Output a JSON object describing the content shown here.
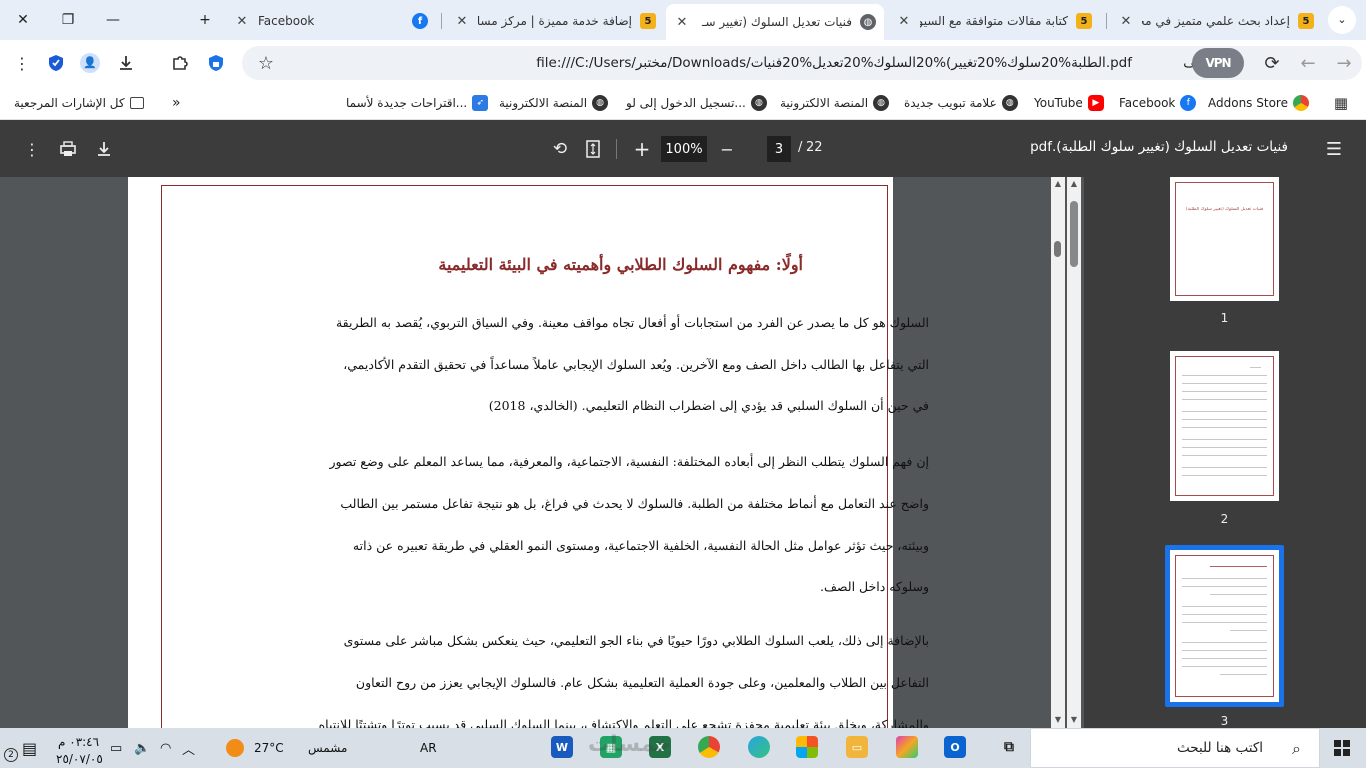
{
  "tabs": [
    {
      "title": "إعداد بحث علمي متميز في مخـ",
      "favicon": "5"
    },
    {
      "title": "كتابة مقالات متوافقة مع السيو",
      "favicon": "5"
    },
    {
      "title": "فنيات تعديل السلوك (تغيير سـ",
      "favicon": "globe"
    },
    {
      "title": "إضافة خدمة مميزة | مركز مساعـ",
      "favicon": "5"
    },
    {
      "title": "Facebook",
      "favicon": "facebook"
    }
  ],
  "window": {
    "new_tab": "+",
    "minimize": "—",
    "restore": "❐",
    "close": "✕"
  },
  "omnibox": {
    "file_label": "ملف",
    "url": "file:///C:/Users/مختبر/Downloads/الطلبة%20سلوك%20تغيير)%20السلوك%20تعديل%20فنيات.pdf",
    "vpn_label": "VPN"
  },
  "bookmarks": [
    {
      "label": "Addons Store",
      "icon": "store"
    },
    {
      "label": "Facebook",
      "icon": "facebook"
    },
    {
      "label": "YouTube",
      "icon": "youtube"
    },
    {
      "label": "علامة تبويب جديدة",
      "icon": "globe"
    },
    {
      "label": "المنصة الالكترونية",
      "icon": "globe"
    },
    {
      "label": "تسجيل الدخول إلى لو...",
      "icon": "globe"
    },
    {
      "label": "المنصة الالكترونية",
      "icon": "globe"
    },
    {
      "label": "اقتراحات جديدة لأسما...",
      "icon": "bird"
    },
    {
      "label": "كل الإشارات المرجعية",
      "icon": "folder"
    }
  ],
  "pdf_toolbar": {
    "doc_title": "فنيات تعديل السلوك (تغيير سلوك الطلبة).pdf",
    "current_page": "3",
    "page_sep": "/",
    "total_pages": "22",
    "zoom": "100%"
  },
  "pdf_page": {
    "heading": "أولًا: مفهوم السلوك الطلابي وأهميته في البيئة التعليمية",
    "lines": [
      "السلوك هو كل ما يصدر عن الفرد من استجابات أو أفعال تجاه مواقف معينة. وفي السياق التربوي، يُقصد به الطريقة",
      "التي يتفاعل بها الطالب داخل الصف ومع الآخرين. ويُعد السلوك الإيجابي عاملاً مساعداً في تحقيق التقدم الأكاديمي،",
      "في حين أن السلوك السلبي قد يؤدي إلى اضطراب النظام التعليمي. (الخالدي، 2018)",
      "إن فهم السلوك يتطلب النظر إلى أبعاده المختلفة: النفسية، الاجتماعية، والمعرفية، مما يساعد المعلم على وضع تصور",
      "واضح عند التعامل مع أنماط مختلفة من الطلبة. فالسلوك لا يحدث في فراغ، بل هو نتيجة تفاعل مستمر بين الطالب",
      "وبيئته، حيث تؤثر عوامل مثل الحالة النفسية، الخلفية الاجتماعية، ومستوى النمو العقلي في طريقة تعبيره عن ذاته",
      "وسلوكه داخل الصف.",
      "بالإضافة إلى ذلك، يلعب السلوك الطلابي دورًا حيويًا في بناء الجو التعليمي، حيث ينعكس بشكل مباشر على مستوى",
      "التفاعل بين الطلاب والمعلمين، وعلى جودة العملية التعليمية بشكل عام. فالسلوك الإيجابي يعزز من روح التعاون",
      "والمشاركة، ويخلق بيئة تعليمية محفزة تشجع على التعلم والاكتشاف، بينما السلوك السلبي قد يسبب توترًا وتشتتًا للانتباه"
    ]
  },
  "thumbnails": [
    {
      "num": "1",
      "title_text": "فنيات تعديل السلوك (تغيير سلوك الطلبة)"
    },
    {
      "num": "2"
    },
    {
      "num": "3",
      "selected": true
    }
  ],
  "taskbar": {
    "search_placeholder": "اكتب هنا للبحث",
    "weather_temp": "27°C",
    "weather_label": "مشمس",
    "language": "AR",
    "time": "٠٣:٤٦ م",
    "date": "٢٥/٠٧/٠٥",
    "notification_count": "2",
    "watermark": "خمسات"
  },
  "colors": {
    "tabstrip": "#e8eef7",
    "pdf_toolbar": "#3c3c3c",
    "viewer_bg": "#525659",
    "heading_color": "#8a2b2b",
    "selection": "#1a73e8",
    "taskbar": "#d9dfe7"
  }
}
